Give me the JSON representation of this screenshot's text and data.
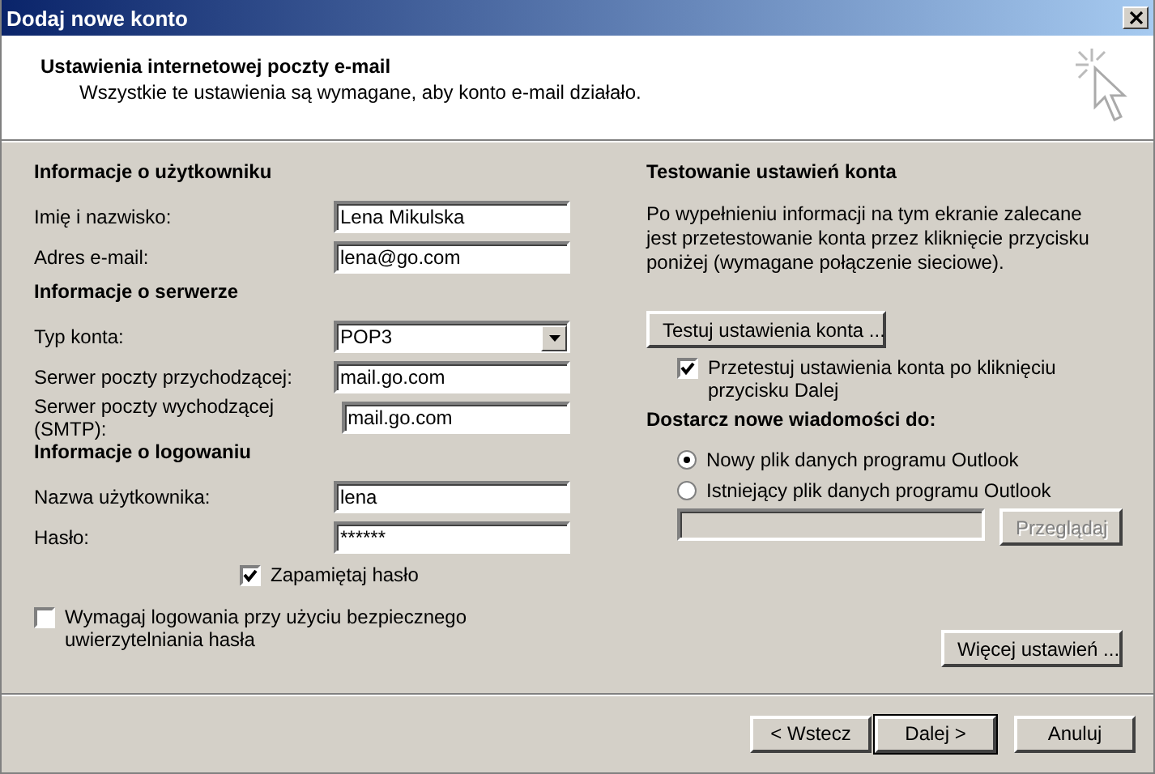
{
  "window": {
    "title": "Dodaj nowe konto"
  },
  "header": {
    "title": "Ustawienia internetowej poczty e-mail",
    "subtitle": "Wszystkie te ustawienia są wymagane, aby konto e-mail działało."
  },
  "sections": [
    {
      "heading": "Informacje o użytkowniku",
      "fields": [
        {
          "kind": "text",
          "label": "Imię i nazwisko:",
          "value": "Lena Mikulska"
        },
        {
          "kind": "text",
          "label": "Adres e-mail:",
          "value": "lena@go.com"
        }
      ]
    },
    {
      "heading": "Informacje o serwerze",
      "fields": [
        {
          "kind": "select",
          "label": "Typ konta:",
          "value": "POP3"
        },
        {
          "kind": "text",
          "label": "Serwer poczty przychodzącej:",
          "value": "mail.go.com"
        },
        {
          "kind": "text",
          "label": "Serwer poczty wychodzącej (SMTP):",
          "value": "mail.go.com"
        }
      ]
    },
    {
      "heading": "Informacje o logowaniu",
      "fields": [
        {
          "kind": "text",
          "label": "Nazwa użytkownika:",
          "value": "lena"
        },
        {
          "kind": "text",
          "label": "Hasło:",
          "value": "******"
        }
      ]
    }
  ],
  "remember_password": {
    "label": "Zapamiętaj hasło",
    "checked": true
  },
  "secure_auth": {
    "label": "Wymagaj logowania przy użyciu bezpiecznego uwierzytelniania hasła",
    "checked": false
  },
  "test": {
    "heading": "Testowanie ustawień konta",
    "text": "Po wypełnieniu informacji na tym ekranie zalecane jest przetestowanie konta przez kliknięcie przycisku poniżej (wymagane połączenie sieciowe).",
    "button": "Testuj ustawienia konta ...",
    "after_next": {
      "label": "Przetestuj ustawienia konta po kliknięciu przycisku Dalej",
      "checked": true
    }
  },
  "deliver": {
    "heading": "Dostarcz nowe wiadomości do:",
    "options": [
      {
        "label": "Nowy plik danych programu Outlook",
        "selected": true
      },
      {
        "label": "Istniejący plik danych programu Outlook",
        "selected": false
      }
    ],
    "browse": {
      "label": "Przeglądaj",
      "disabled": true
    }
  },
  "more_settings": "Więcej ustawień ...",
  "buttons": [
    {
      "label": "< Wstecz",
      "default": false
    },
    {
      "label": "Dalej >",
      "default": true
    },
    {
      "label": "Anuluj",
      "default": false
    }
  ]
}
